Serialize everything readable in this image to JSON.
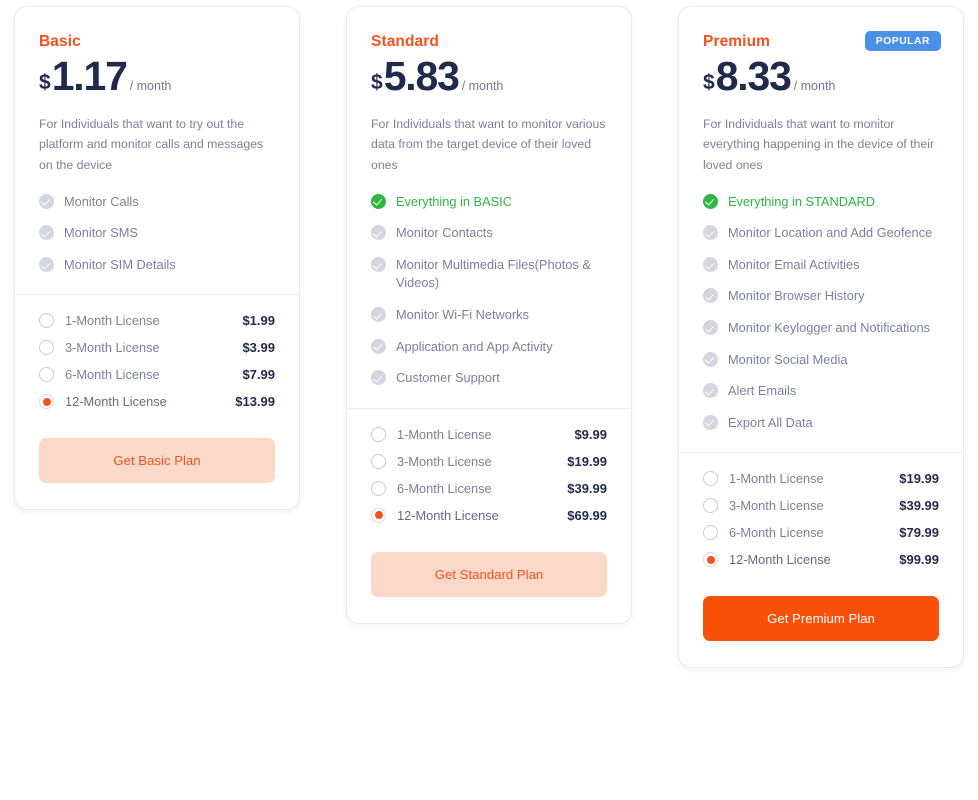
{
  "theme": {
    "accent_orange": "#f4511e",
    "solid_orange": "#f9500a",
    "soft_orange_bg": "#fbd9c9",
    "navy": "#1f2a4d",
    "muted_gray": "#7b8298",
    "included_green": "#2db742",
    "badge_blue": "#4a90e8",
    "check_gray": "#d3d6de"
  },
  "plans": [
    {
      "id": "basic",
      "name": "Basic",
      "currency": "$",
      "amount": "1.17",
      "period": "/ month",
      "description": "For Individuals that want to try out the platform and monitor calls and messages on the device",
      "badge": null,
      "features": [
        {
          "label": "Monitor Calls",
          "included_highlight": false
        },
        {
          "label": "Monitor SMS",
          "included_highlight": false
        },
        {
          "label": "Monitor SIM Details",
          "included_highlight": false
        }
      ],
      "licenses": [
        {
          "label": "1-Month License",
          "price": "$1.99",
          "selected": false
        },
        {
          "label": "3-Month License",
          "price": "$3.99",
          "selected": false
        },
        {
          "label": "6-Month License",
          "price": "$7.99",
          "selected": false
        },
        {
          "label": "12-Month License",
          "price": "$13.99",
          "selected": true
        }
      ],
      "cta_label": "Get Basic Plan",
      "cta_style": "soft"
    },
    {
      "id": "standard",
      "name": "Standard",
      "currency": "$",
      "amount": "5.83",
      "period": "/ month",
      "description": "For Individuals that want to monitor various data from the target device of their loved ones",
      "badge": null,
      "features": [
        {
          "label": "Everything in BASIC",
          "included_highlight": true
        },
        {
          "label": "Monitor Contacts",
          "included_highlight": false
        },
        {
          "label": "Monitor Multimedia Files(Photos & Videos)",
          "included_highlight": false
        },
        {
          "label": "Monitor Wi-Fi Networks",
          "included_highlight": false
        },
        {
          "label": "Application and App Activity",
          "included_highlight": false
        },
        {
          "label": "Customer Support",
          "included_highlight": false
        }
      ],
      "licenses": [
        {
          "label": "1-Month License",
          "price": "$9.99",
          "selected": false
        },
        {
          "label": "3-Month License",
          "price": "$19.99",
          "selected": false
        },
        {
          "label": "6-Month License",
          "price": "$39.99",
          "selected": false
        },
        {
          "label": "12-Month License",
          "price": "$69.99",
          "selected": true
        }
      ],
      "cta_label": "Get Standard Plan",
      "cta_style": "soft"
    },
    {
      "id": "premium",
      "name": "Premium",
      "currency": "$",
      "amount": "8.33",
      "period": "/ month",
      "description": "For Individuals that want to monitor everything happening in the device of their loved ones",
      "badge": "POPULAR",
      "features": [
        {
          "label": "Everything in STANDARD",
          "included_highlight": true
        },
        {
          "label": "Monitor Location and Add Geofence",
          "included_highlight": false
        },
        {
          "label": "Monitor Email Activities",
          "included_highlight": false
        },
        {
          "label": "Monitor Browser History",
          "included_highlight": false
        },
        {
          "label": "Monitor Keylogger and Notifications",
          "included_highlight": false
        },
        {
          "label": "Monitor Social Media",
          "included_highlight": false
        },
        {
          "label": "Alert Emails",
          "included_highlight": false
        },
        {
          "label": "Export All Data",
          "included_highlight": false
        }
      ],
      "licenses": [
        {
          "label": "1-Month License",
          "price": "$19.99",
          "selected": false
        },
        {
          "label": "3-Month License",
          "price": "$39.99",
          "selected": false
        },
        {
          "label": "6-Month License",
          "price": "$79.99",
          "selected": false
        },
        {
          "label": "12-Month License",
          "price": "$99.99",
          "selected": true
        }
      ],
      "cta_label": "Get Premium Plan",
      "cta_style": "solid"
    }
  ]
}
